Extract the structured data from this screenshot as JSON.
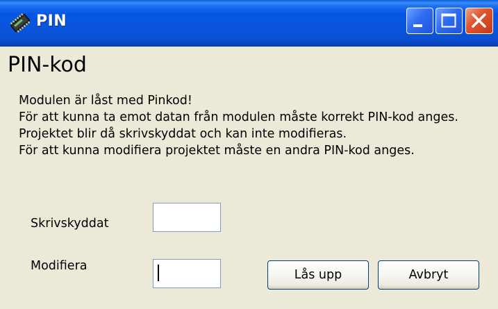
{
  "window": {
    "title": "PIN",
    "icon": "chip-icon",
    "controls": {
      "minimize": "minimize-icon",
      "maximize": "maximize-icon",
      "close": "close-icon"
    },
    "colors": {
      "titlebar": "#0656e4",
      "client": "#ece9d8",
      "close_button": "#e0552e"
    }
  },
  "dialog": {
    "heading": "PIN-kod",
    "message_lines": [
      "Modulen är låst med Pinkod!",
      "För att kunna ta emot datan från modulen måste korrekt PIN-kod anges.",
      "Projektet blir då skrivskyddat och kan inte modifieras.",
      "För att kunna modifiera projektet måste en andra PIN-kod anges."
    ],
    "fields": {
      "write_protected": {
        "label": "Skrivskyddat",
        "value": ""
      },
      "modify": {
        "label": "Modifiera",
        "value": ""
      }
    },
    "buttons": {
      "unlock": "Lås upp",
      "cancel": "Avbryt"
    }
  }
}
